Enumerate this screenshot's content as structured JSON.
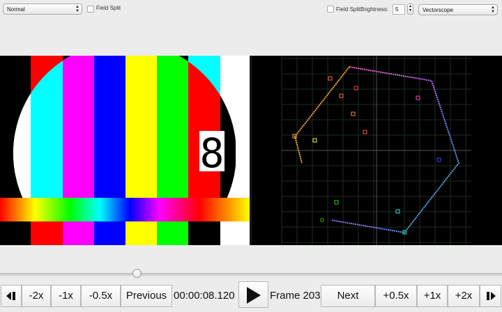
{
  "toolbar": {
    "mode_select": "Normal",
    "field_split_left": "Field Split",
    "field_split_right": "Field Split",
    "brightness_label": "Brightness:",
    "brightness_value": "5",
    "scope_select": "Vectorscope"
  },
  "video": {
    "frame_digit": "8",
    "bar_colors": [
      "#000000",
      "#00ffff",
      "#ff00ff",
      "#0000ff",
      "#ffff00",
      "#00ff00",
      "#ff0000",
      "#00ffff",
      "#ffffff"
    ]
  },
  "scope": {
    "grid_color": "#1f3320",
    "axis_color": "#4a4a4a"
  },
  "playback": {
    "progress": 0.27
  },
  "controls": {
    "minus2": "-2x",
    "minus1": "-1x",
    "minus05": "-0.5x",
    "previous": "Previous",
    "timecode": "00:00:08.120",
    "frame": "Frame 203",
    "next": "Next",
    "plus05": "+0.5x",
    "plus1": "+1x",
    "plus2": "+2x"
  }
}
